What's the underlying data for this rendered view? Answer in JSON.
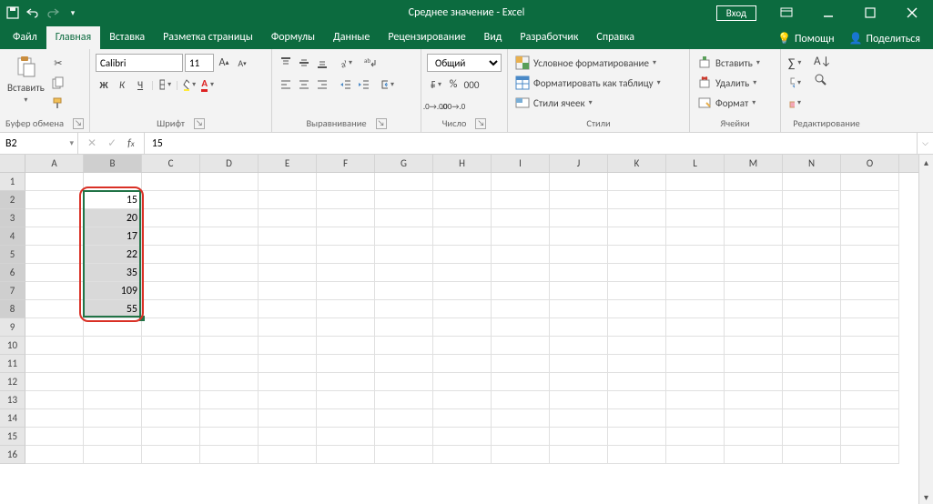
{
  "title": "Среднее значение  -  Excel",
  "signin": "Вход",
  "tabs": {
    "file": "Файл",
    "home": "Главная",
    "insert": "Вставка",
    "layout": "Разметка страницы",
    "formulas": "Формулы",
    "data": "Данные",
    "review": "Рецензирование",
    "view": "Вид",
    "developer": "Разработчик",
    "help": "Справка",
    "tellme": "Помощн",
    "share": "Поделиться"
  },
  "ribbon": {
    "clipboard": {
      "paste": "Вставить",
      "label": "Буфер обмена"
    },
    "font": {
      "name": "Calibri",
      "size": "11",
      "label": "Шрифт",
      "bold": "Ж",
      "italic": "К",
      "underline": "Ч"
    },
    "alignment": {
      "label": "Выравнивание"
    },
    "number": {
      "format": "Общий",
      "label": "Число"
    },
    "styles": {
      "cond": "Условное форматирование",
      "table": "Форматировать как таблицу",
      "cell": "Стили ячеек",
      "label": "Стили"
    },
    "cells": {
      "insert": "Вставить",
      "delete": "Удалить",
      "format": "Формат",
      "label": "Ячейки"
    },
    "editing": {
      "label": "Редактирование"
    }
  },
  "namebox": "B2",
  "formula": "15",
  "columns": [
    "A",
    "B",
    "C",
    "D",
    "E",
    "F",
    "G",
    "H",
    "I",
    "J",
    "K",
    "L",
    "M",
    "N",
    "O"
  ],
  "selected_col": "B",
  "row_count": 16,
  "selected_rows": [
    2,
    3,
    4,
    5,
    6,
    7,
    8
  ],
  "cell_data": {
    "B2": "15",
    "B3": "20",
    "B4": "17",
    "B5": "22",
    "B6": "35",
    "B7": "109",
    "B8": "55"
  },
  "colors": {
    "accent": "#0c6b3f",
    "selection": "#217346",
    "highlight_red": "#d93025"
  }
}
